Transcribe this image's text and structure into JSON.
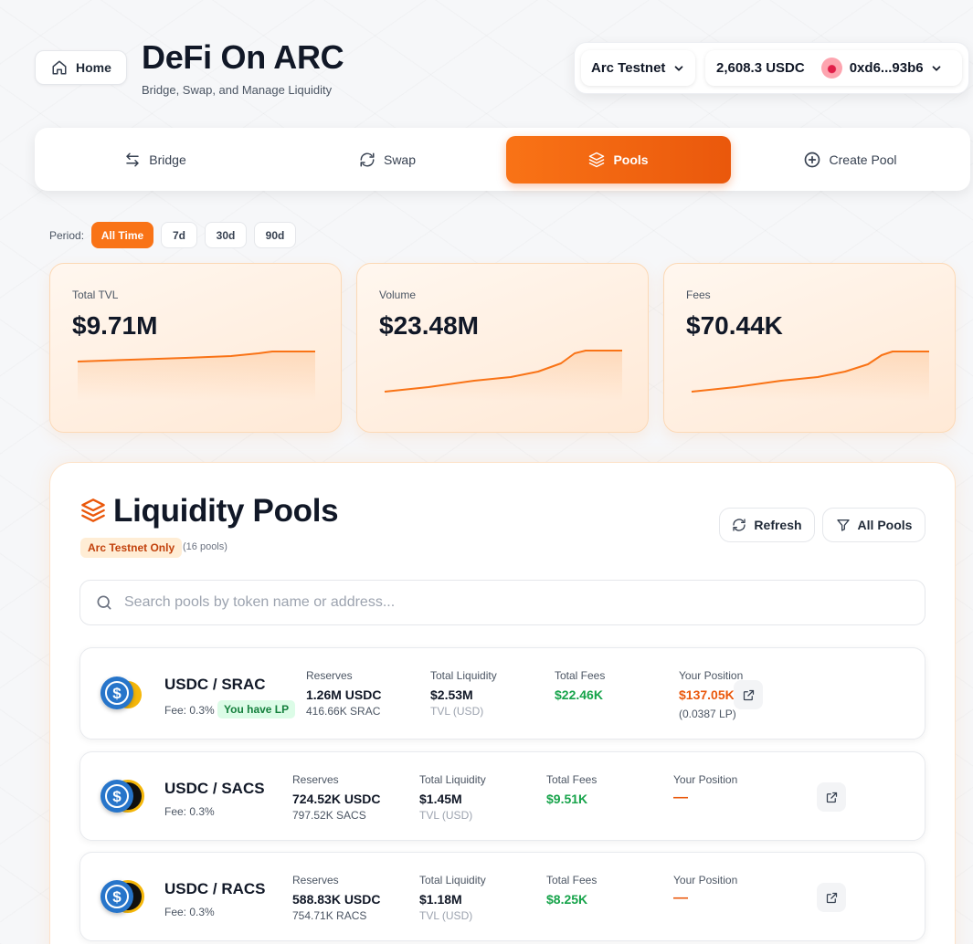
{
  "header": {
    "home_label": "Home",
    "title": "DeFi On ARC",
    "subtitle": "Bridge, Swap, and Manage Liquidity",
    "network": "Arc Testnet",
    "balance": "2,608.3 USDC",
    "address": "0xd6...93b6"
  },
  "nav": {
    "tabs": [
      {
        "label": "Bridge",
        "icon": "swap-arrows-icon"
      },
      {
        "label": "Swap",
        "icon": "refresh-icon"
      },
      {
        "label": "Pools",
        "icon": "layers-icon",
        "active": true
      },
      {
        "label": "Create Pool",
        "icon": "plus-circle-icon"
      }
    ]
  },
  "period": {
    "label": "Period:",
    "options": [
      "All Time",
      "7d",
      "30d",
      "90d"
    ],
    "selected": "All Time"
  },
  "stats": [
    {
      "label": "Total TVL",
      "value": "$9.71M"
    },
    {
      "label": "Volume",
      "value": "$23.48M"
    },
    {
      "label": "Fees",
      "value": "$70.44K"
    }
  ],
  "pools": {
    "title": "Liquidity Pools",
    "badge": "Arc Testnet Only",
    "count": "(16 pools)",
    "refresh_label": "Refresh",
    "filter_label": "All Pools",
    "search_placeholder": "Search pools by token name or address...",
    "columns": {
      "reserves": "Reserves",
      "liquidity": "Total Liquidity",
      "fees": "Total Fees",
      "position": "Your Position",
      "tvl_note": "TVL (USD)"
    },
    "items": [
      {
        "pair": "USDC / SRAC",
        "fee": "Fee: 0.3%",
        "lp_badge": "You have LP",
        "reserve_a": "1.26M USDC",
        "reserve_b": "416.66K SRAC",
        "liquidity": "$2.53M",
        "fees": "$22.46K",
        "position": "$137.05K",
        "position_lp": "(0.0387 LP)"
      },
      {
        "pair": "USDC / SACS",
        "fee": "Fee: 0.3%",
        "reserve_a": "724.52K USDC",
        "reserve_b": "797.52K SACS",
        "liquidity": "$1.45M",
        "fees": "$9.51K",
        "position": "—"
      },
      {
        "pair": "USDC / RACS",
        "fee": "Fee: 0.3%",
        "reserve_a": "588.83K USDC",
        "reserve_b": "754.71K RACS",
        "liquidity": "$1.18M",
        "fees": "$8.25K",
        "position": "—"
      }
    ]
  },
  "colors": {
    "accent": "#f97316",
    "accent_dark": "#ea580c",
    "usdc": "#2775ca",
    "positive": "#16a34a"
  }
}
